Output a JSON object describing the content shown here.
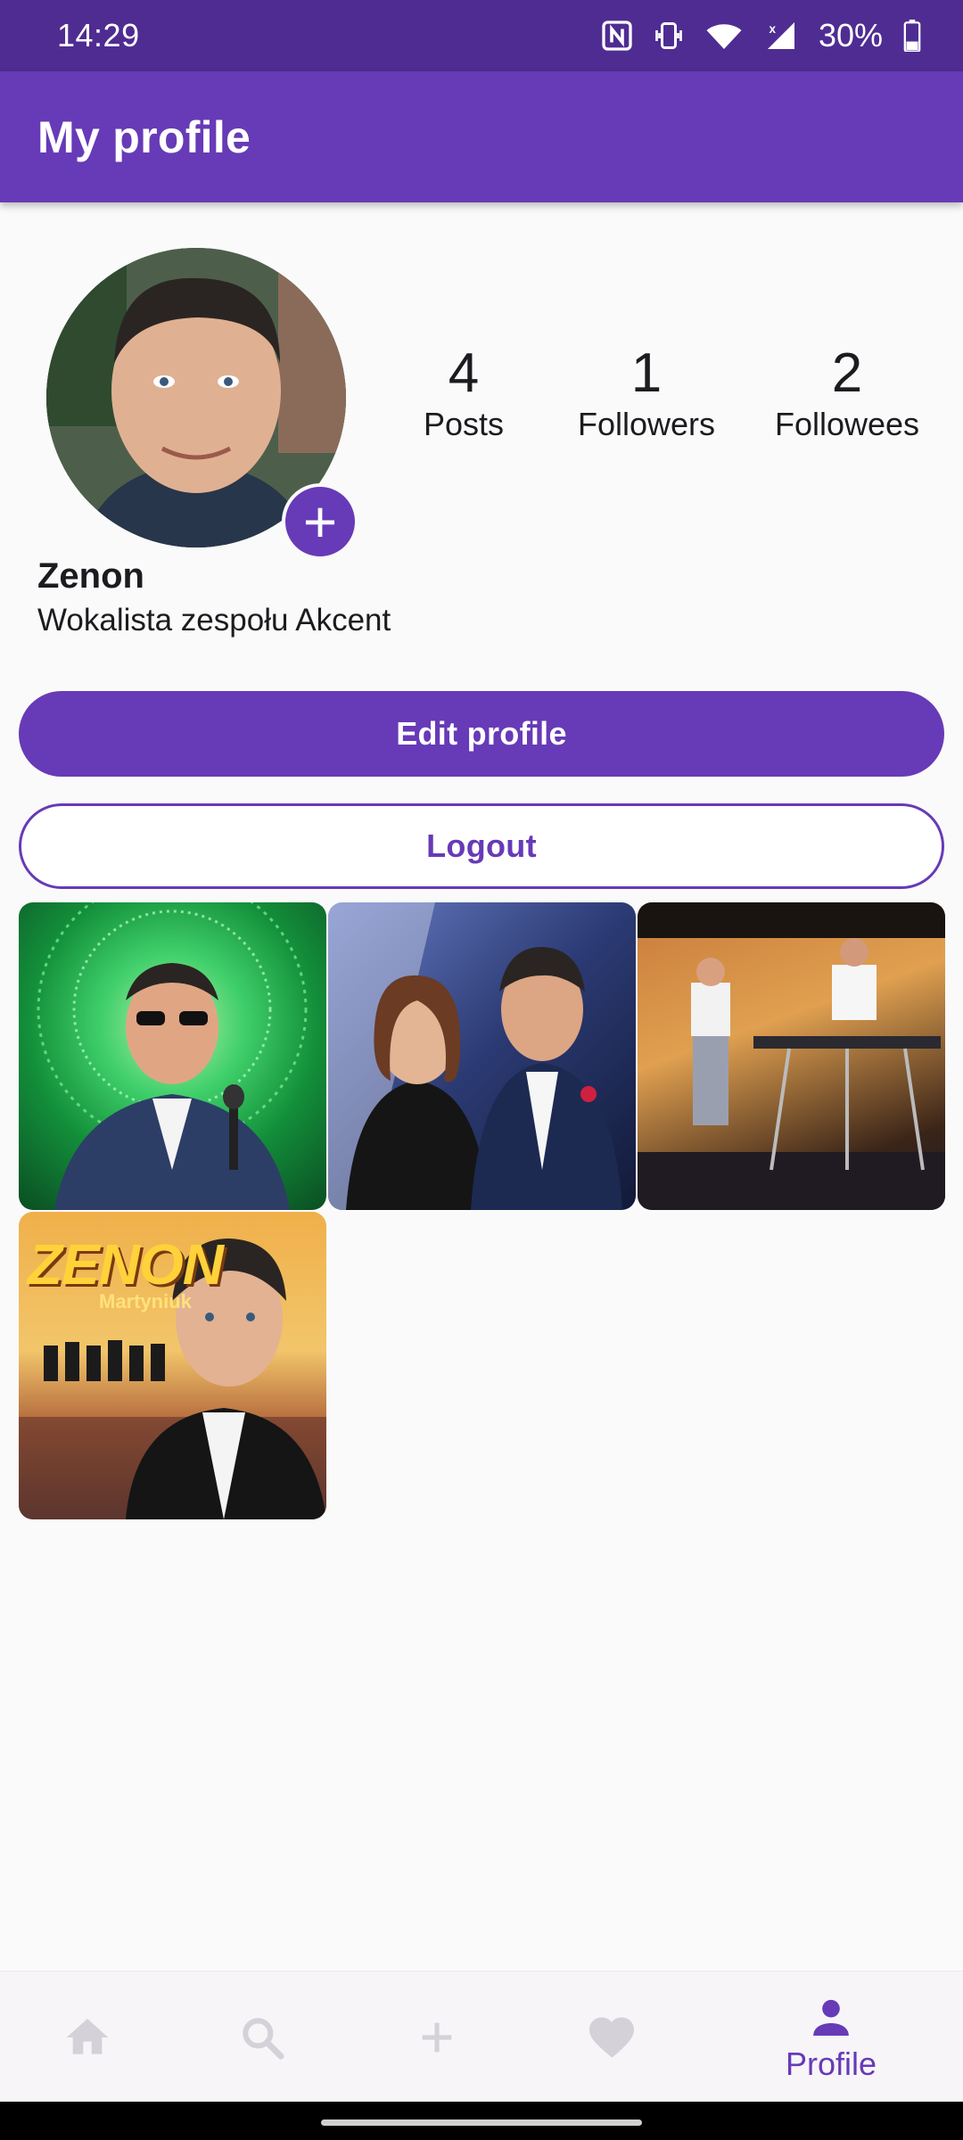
{
  "status_bar": {
    "time": "14:29",
    "battery": "30%",
    "icons": [
      "nfc-icon",
      "vibrate-icon",
      "wifi-icon",
      "signal-icon",
      "battery-icon"
    ]
  },
  "app_bar": {
    "title": "My profile"
  },
  "profile": {
    "name": "Zenon",
    "bio": "Wokalista zespołu Akcent",
    "avatar_add_icon": "plus-icon"
  },
  "stats": [
    {
      "value": "4",
      "label": "Posts"
    },
    {
      "value": "1",
      "label": "Followers"
    },
    {
      "value": "2",
      "label": "Followees"
    }
  ],
  "buttons": {
    "edit": "Edit profile",
    "logout": "Logout"
  },
  "posts": {
    "zenon_cover": {
      "title": "ZENON",
      "subtitle": "Martyniuk"
    }
  },
  "bottom_nav": {
    "items": [
      {
        "icon": "home-icon",
        "label": ""
      },
      {
        "icon": "search-icon",
        "label": ""
      },
      {
        "icon": "plus-icon",
        "label": ""
      },
      {
        "icon": "heart-icon",
        "label": ""
      },
      {
        "icon": "person-icon",
        "label": "Profile",
        "active": true
      }
    ]
  },
  "colors": {
    "primary": "#673ab7",
    "status_bar": "#4f2c92",
    "background": "#fafafa",
    "nav_inactive": "#d4d1d8"
  }
}
